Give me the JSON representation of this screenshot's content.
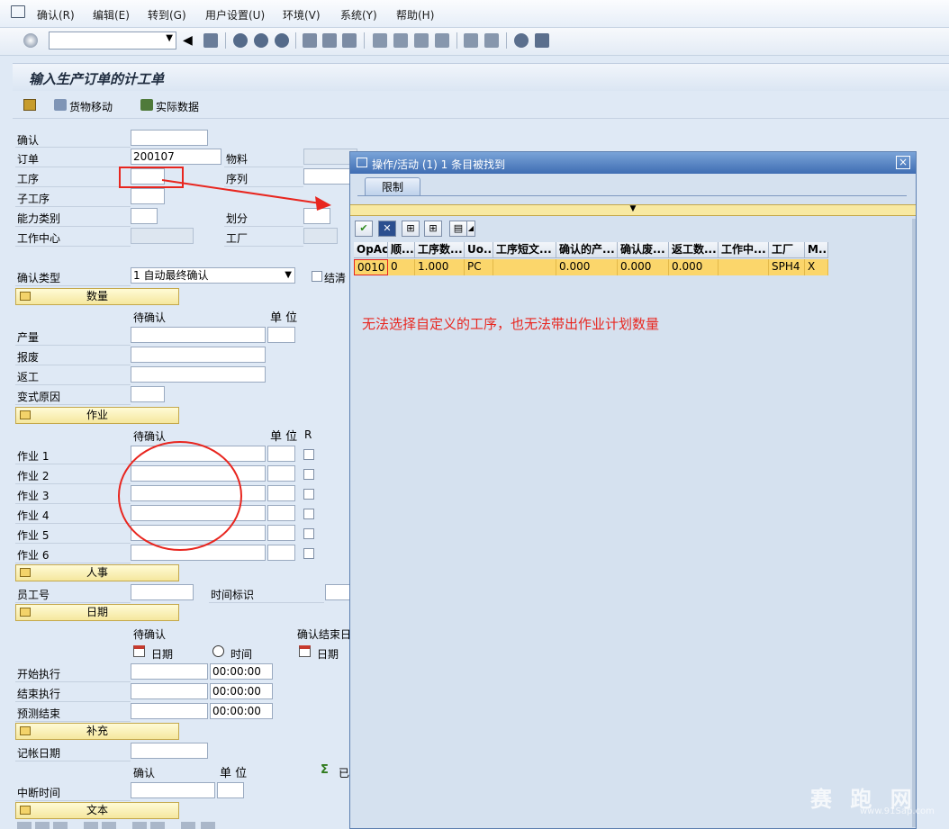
{
  "menu": [
    "确认(R)",
    "编辑(E)",
    "转到(G)",
    "用户设置(U)",
    "环境(V)",
    "系统(Y)",
    "帮助(H)"
  ],
  "title": "输入生产订单的计工单",
  "app_toolbar": {
    "goods_movement": "货物移动",
    "actual_data": "实际数据"
  },
  "header": {
    "confirm_label": "确认",
    "order_label": "订单",
    "order_value": "200107",
    "material_label": "物料",
    "operation_label": "工序",
    "sequence_label": "序列",
    "sub_operation_label": "子工序",
    "capacity_label": "能力类别",
    "split_label": "划分",
    "work_center_label": "工作中心",
    "plant_label": "工厂",
    "confirm_type_label": "确认类型",
    "confirm_type_value": "1 自动最终确认",
    "clear_label": "结清"
  },
  "sections": {
    "quantity": "数量",
    "activity": "作业",
    "personnel": "人事",
    "dates": "日期",
    "supplement": "补充",
    "text": "文本"
  },
  "quantity": {
    "to_confirm": "待确认",
    "unit": "单 位",
    "rows": [
      "产量",
      "报废",
      "返工",
      "变式原因"
    ]
  },
  "activity": {
    "to_confirm": "待确认",
    "unit": "单 位",
    "r": "R",
    "rows": [
      "作业 1",
      "作业 2",
      "作业 3",
      "作业 4",
      "作业 5",
      "作业 6"
    ]
  },
  "personnel": {
    "employee_label": "员工号",
    "time_id_label": "时间标识"
  },
  "dates": {
    "to_confirm": "待确认",
    "confirm_end": "确认结束日",
    "date_label": "日期",
    "time_label": "时间",
    "date_label2": "日期",
    "rows": [
      {
        "label": "开始执行",
        "time": "00:00:00"
      },
      {
        "label": "结束执行",
        "time": "00:00:00"
      },
      {
        "label": "预测结束",
        "time": "00:00:00"
      }
    ]
  },
  "supplement": {
    "posting_date_label": "记帐日期",
    "confirm_label": "确认",
    "unit": "单 位",
    "sigma_label": "已",
    "break_label": "中断时间"
  },
  "dialog": {
    "title": "操作/活动 (1)   1 条目被找到",
    "close": "×",
    "tab": "限制",
    "columns": [
      "OpAc",
      "顺...",
      "工序数...",
      "Uo...",
      "工序短文...",
      "确认的产...",
      "确认废...",
      "返工数...",
      "工作中...",
      "工厂",
      "M..."
    ],
    "row": [
      "0010",
      "0",
      "1.000",
      "PC",
      "",
      "0.000",
      "0.000",
      "0.000",
      "",
      "SPH4",
      "X"
    ]
  },
  "annotation": "无法选择自定义的工序，也无法带出作业计划数量",
  "watermark": {
    "text": "赛 跑 网",
    "url": "www.91Sap.com"
  }
}
